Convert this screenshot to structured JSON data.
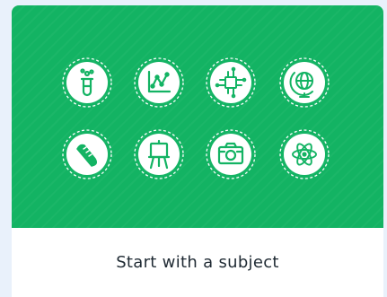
{
  "card": {
    "caption": "Start with a subject",
    "banner_color": "#13b363",
    "icons": [
      {
        "name": "test-tube-icon"
      },
      {
        "name": "chart-icon"
      },
      {
        "name": "circuit-chip-icon"
      },
      {
        "name": "globe-icon"
      },
      {
        "name": "sneaker-icon"
      },
      {
        "name": "easel-icon"
      },
      {
        "name": "camera-icon"
      },
      {
        "name": "atom-icon"
      }
    ]
  }
}
